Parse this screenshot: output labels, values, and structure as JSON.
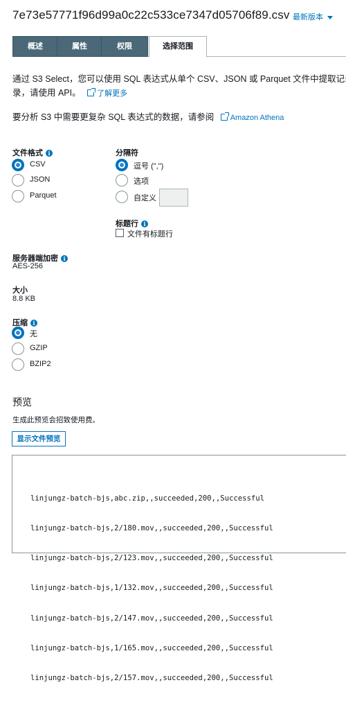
{
  "header": {
    "file_name": "7e73e57771f96d99a0c22c533ce7347d05706f89.csv",
    "version_label": "最新版本"
  },
  "tabs": [
    {
      "label": "概述",
      "active": false
    },
    {
      "label": "属性",
      "active": false
    },
    {
      "label": "权限",
      "active": false
    },
    {
      "label": "选择范围",
      "active": true
    }
  ],
  "intro": {
    "line1": "通过 S3 Select，您可以使用 SQL 表达式从单个 CSV、JSON 或 Parquet 文件中提取记录",
    "line2": "录，请使用 API。",
    "learn_more": "了解更多",
    "athena_text": "要分析 S3 中需要更复杂 SQL 表达式的数据，请参阅",
    "athena_link": "Amazon Athena"
  },
  "file_format": {
    "label": "文件格式",
    "options": [
      "CSV",
      "JSON",
      "Parquet"
    ],
    "selected": "CSV"
  },
  "delimiter": {
    "label": "分隔符",
    "options": [
      "逗号 (\",\")",
      "选项",
      "自定义"
    ],
    "selected": "逗号 (\",\")",
    "custom_value": ""
  },
  "header_row": {
    "label": "标题行",
    "checkbox_label": "文件有标题行",
    "checked": false
  },
  "encryption": {
    "label": "服务器端加密",
    "value": "AES-256"
  },
  "size": {
    "label": "大小",
    "value": "8.8 KB"
  },
  "compression": {
    "label": "压缩",
    "options": [
      "无",
      "GZIP",
      "BZIP2"
    ],
    "selected": "无"
  },
  "preview": {
    "title": "预览",
    "note": "生成此预览会招致使用费。",
    "button_label": "显示文件预览",
    "lines": [
      "linjungz-batch-bjs,abc.zip,,succeeded,200,,Successful",
      "linjungz-batch-bjs,2/180.mov,,succeeded,200,,Successful",
      "linjungz-batch-bjs,2/123.mov,,succeeded,200,,Successful",
      "linjungz-batch-bjs,1/132.mov,,succeeded,200,,Successful",
      "linjungz-batch-bjs,2/147.mov,,succeeded,200,,Successful",
      "linjungz-batch-bjs,1/165.mov,,succeeded,200,,Successful",
      "linjungz-batch-bjs,2/157.mov,,succeeded,200,,Successful"
    ]
  },
  "colors": {
    "accent": "#0073bb",
    "tab_bg": "#4b6879",
    "text": "#16191f"
  }
}
